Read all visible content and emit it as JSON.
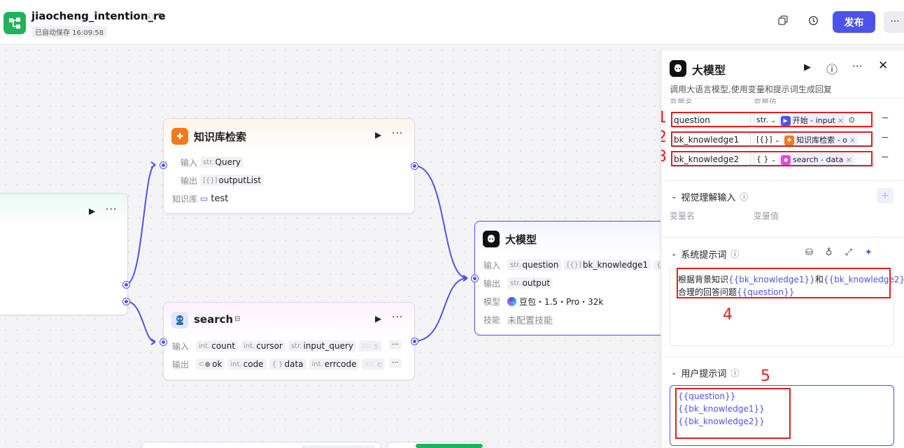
{
  "header": {
    "title": "jiaocheng_intention_re",
    "saved": "已自动保存 16:09:58",
    "publish": "发布"
  },
  "nodes": {
    "start": {
      "ellipsis": "···"
    },
    "kb": {
      "title": "知识库检索",
      "in_label": "输入",
      "in_type": "str.",
      "in_val": "Query",
      "out_label": "输出",
      "out_type": "[{}]",
      "out_val": "outputList",
      "kb_label": "知识库",
      "kb_val": "test"
    },
    "search": {
      "title": "search",
      "in_label": "输入",
      "inputs": [
        {
          "t": "int.",
          "v": "count"
        },
        {
          "t": "int.",
          "v": "cursor"
        },
        {
          "t": "str.",
          "v": "input_query"
        },
        {
          "t": "str.",
          "v": "s"
        }
      ],
      "out_label": "输出",
      "outputs": [
        {
          "t": "",
          "v": "ok"
        },
        {
          "t": "int.",
          "v": "code"
        },
        {
          "t": "{ }",
          "v": "data"
        },
        {
          "t": "int.",
          "v": "errcode"
        },
        {
          "t": "str.",
          "v": "e"
        }
      ]
    },
    "llm": {
      "title": "大模型",
      "in_label": "输入",
      "in1_type": "str.",
      "in1_val": "question",
      "in2_type": "[{}]",
      "in2_val": "bk_knowledge1",
      "in3_type": "{ }",
      "out_label": "输出",
      "out_type": "str.",
      "out_val": "output",
      "model_label": "模型",
      "model_val": "豆包・1.5・Pro・32k",
      "skill_label": "技能",
      "skill_val": "未配置技能"
    }
  },
  "panel": {
    "title": "大模型",
    "desc": "调用大语言模型,使用变量和提示词生成回复",
    "col_name": "变量名",
    "col_value": "变量值",
    "vars": [
      {
        "num": "1",
        "name": "question",
        "type": "str.",
        "ref": "开始 - input",
        "ref_color": "#4d53e8",
        "ref_icon": "▶"
      },
      {
        "num": "2",
        "name": "bk_knowledge1",
        "type": "[{}]",
        "ref": "知识库检索 - o",
        "ref_color": "#f07a1e",
        "ref_icon": "✚"
      },
      {
        "num": "3",
        "name": "bk_knowledge2",
        "type": "{ }",
        "ref": "search - data",
        "ref_color": "#d94fe0",
        "ref_icon": "◆"
      }
    ],
    "visual": {
      "title": "视觉理解输入",
      "col_name": "变量名",
      "col_value": "变量值"
    },
    "system": {
      "title": "系统提示词",
      "l1_a": "根据背景知识",
      "l1_v1": "{{bk_knowledge1}}",
      "l1_b": "和",
      "l1_v2": "{{bk_knowledge2}}",
      "l2_a": "合理的回答问题",
      "l2_v": "{{question}}",
      "num": "4"
    },
    "user": {
      "title": "用户提示词",
      "num": "5",
      "lines": [
        "{{question}}",
        "{{bk_knowledge1}}",
        "{{bk_knowledge2}}"
      ]
    }
  }
}
